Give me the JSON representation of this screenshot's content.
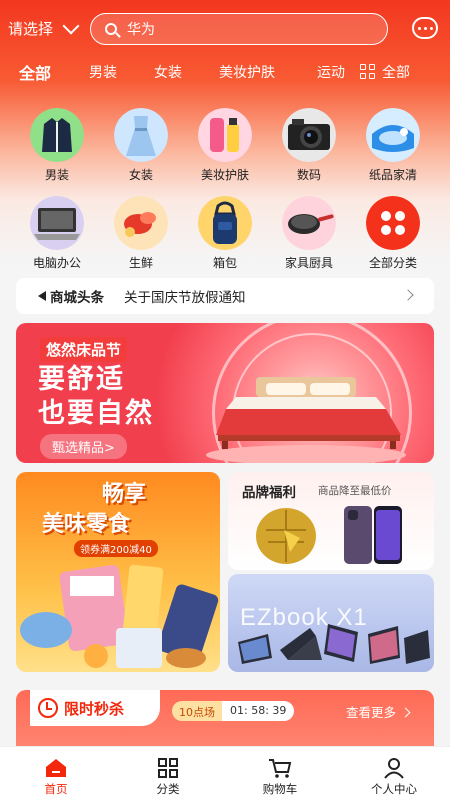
{
  "header": {
    "location": "请选择",
    "search_value": "华为"
  },
  "tabs": [
    {
      "label": "全部",
      "active": true
    },
    {
      "label": "男装"
    },
    {
      "label": "女装"
    },
    {
      "label": "美妆护肤"
    },
    {
      "label": "运动"
    },
    {
      "label": "全部"
    }
  ],
  "categories": [
    {
      "label": "男装",
      "icon": "jacket-icon"
    },
    {
      "label": "女装",
      "icon": "dress-icon"
    },
    {
      "label": "美妆护肤",
      "icon": "cosmetics-icon"
    },
    {
      "label": "数码",
      "icon": "camera-icon"
    },
    {
      "label": "纸品家清",
      "icon": "household-icon"
    },
    {
      "label": "电脑办公",
      "icon": "laptop-icon"
    },
    {
      "label": "生鲜",
      "icon": "seafood-icon"
    },
    {
      "label": "箱包",
      "icon": "bag-icon"
    },
    {
      "label": "家具厨具",
      "icon": "pan-icon"
    },
    {
      "label": "全部分类",
      "icon": "all-categories-icon"
    }
  ],
  "news": {
    "title": "商城头条",
    "text": "关于国庆节放假通知"
  },
  "banner": {
    "tag": "悠然床品节",
    "headline_1": "要舒适",
    "headline_2": "也要自然",
    "cta": "甄选精品>"
  },
  "promos": {
    "snack_title_1": "畅享",
    "snack_title_2": "美味零食",
    "snack_coupon": "领券满200减40",
    "brand_title": "品牌福利",
    "brand_subtitle": "商品降至最低价",
    "laptop_title": "EZbook X1"
  },
  "flash_sale": {
    "title": "限时秒杀",
    "session": "10点场",
    "countdown": "01: 58: 39",
    "more": "查看更多"
  },
  "tabbar": [
    {
      "label": "首页",
      "icon": "home-icon",
      "active": true
    },
    {
      "label": "分类",
      "icon": "category-grid-icon"
    },
    {
      "label": "购物车",
      "icon": "cart-icon"
    },
    {
      "label": "个人中心",
      "icon": "user-icon"
    }
  ],
  "colors": {
    "accent": "#f2270c",
    "header_top": "#f3371f"
  }
}
